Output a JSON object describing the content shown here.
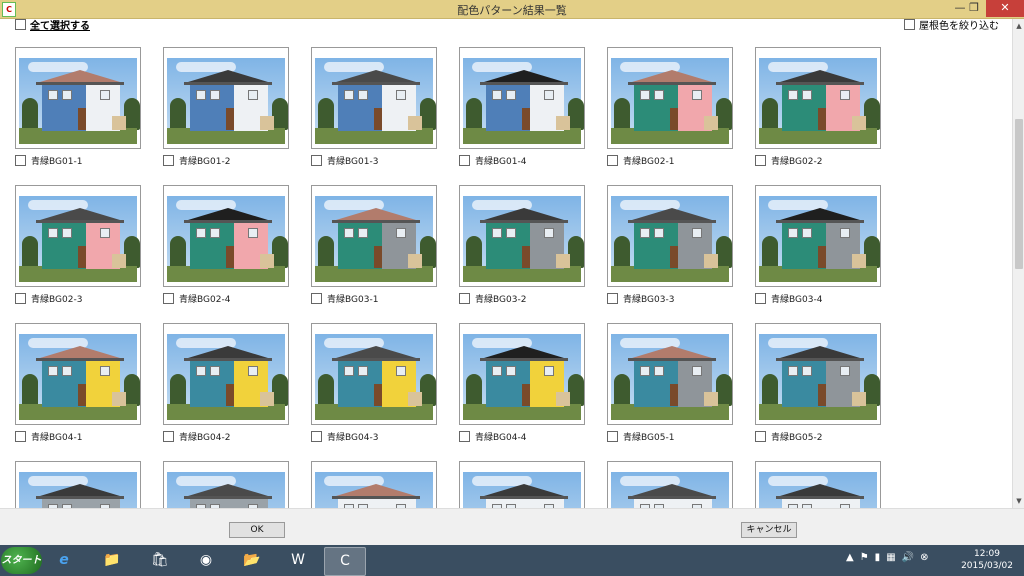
{
  "window": {
    "title": "配色パターン結果一覧",
    "minimize": "—",
    "restore": "❐",
    "close": "✕",
    "app_icon": "C"
  },
  "header": {
    "select_all_label": "全て選択する",
    "roof_filter_label": "屋根色を絞り込む"
  },
  "items": [
    {
      "label": "青緑BG01-1",
      "roof": "#b27c6c",
      "wall_left": "#4f7fb8",
      "wall_right": "#eef1f4"
    },
    {
      "label": "青緑BG01-2",
      "roof": "#3a3a3a",
      "wall_left": "#4f7fb8",
      "wall_right": "#eef1f4"
    },
    {
      "label": "青緑BG01-3",
      "roof": "#4a4a4a",
      "wall_left": "#4f7fb8",
      "wall_right": "#eef1f4"
    },
    {
      "label": "青緑BG01-4",
      "roof": "#1f1f1f",
      "wall_left": "#4f7fb8",
      "wall_right": "#eef1f4"
    },
    {
      "label": "青緑BG02-1",
      "roof": "#b27c6c",
      "wall_left": "#2c8c78",
      "wall_right": "#f1a7ac"
    },
    {
      "label": "青緑BG02-2",
      "roof": "#3a3a3a",
      "wall_left": "#2c8c78",
      "wall_right": "#f1a7ac"
    },
    {
      "label": "青緑BG02-3",
      "roof": "#4a4a4a",
      "wall_left": "#2c8c78",
      "wall_right": "#f1a7ac"
    },
    {
      "label": "青緑BG02-4",
      "roof": "#1f1f1f",
      "wall_left": "#2c8c78",
      "wall_right": "#f1a7ac"
    },
    {
      "label": "青緑BG03-1",
      "roof": "#b27c6c",
      "wall_left": "#2c8c78",
      "wall_right": "#8f959a"
    },
    {
      "label": "青緑BG03-2",
      "roof": "#3a3a3a",
      "wall_left": "#2c8c78",
      "wall_right": "#8f959a"
    },
    {
      "label": "青緑BG03-3",
      "roof": "#4a4a4a",
      "wall_left": "#2c8c78",
      "wall_right": "#8f959a"
    },
    {
      "label": "青緑BG03-4",
      "roof": "#1f1f1f",
      "wall_left": "#2c8c78",
      "wall_right": "#8f959a"
    },
    {
      "label": "青緑BG04-1",
      "roof": "#b27c6c",
      "wall_left": "#3a8aa0",
      "wall_right": "#f1d23b"
    },
    {
      "label": "青緑BG04-2",
      "roof": "#3a3a3a",
      "wall_left": "#3a8aa0",
      "wall_right": "#f1d23b"
    },
    {
      "label": "青緑BG04-3",
      "roof": "#4a4a4a",
      "wall_left": "#3a8aa0",
      "wall_right": "#f1d23b"
    },
    {
      "label": "青緑BG04-4",
      "roof": "#1f1f1f",
      "wall_left": "#3a8aa0",
      "wall_right": "#f1d23b"
    },
    {
      "label": "青緑BG05-1",
      "roof": "#b27c6c",
      "wall_left": "#3a8aa0",
      "wall_right": "#8f959a"
    },
    {
      "label": "青緑BG05-2",
      "roof": "#3a3a3a",
      "wall_left": "#3a8aa0",
      "wall_right": "#8f959a"
    },
    {
      "label": "",
      "roof": "#3a3a3a",
      "wall_left": "#9aa2a8",
      "wall_right": "#9aa2a8"
    },
    {
      "label": "",
      "roof": "#4a4a4a",
      "wall_left": "#9aa2a8",
      "wall_right": "#9aa2a8"
    },
    {
      "label": "",
      "roof": "#b27c6c",
      "wall_left": "#eef1f4",
      "wall_right": "#eef1f4"
    },
    {
      "label": "",
      "roof": "#3a3a3a",
      "wall_left": "#eef1f4",
      "wall_right": "#eef1f4"
    },
    {
      "label": "",
      "roof": "#4a4a4a",
      "wall_left": "#eef1f4",
      "wall_right": "#eef1f4"
    },
    {
      "label": "",
      "roof": "#3a3a3a",
      "wall_left": "#eef1f4",
      "wall_right": "#eef1f4"
    }
  ],
  "footer": {
    "ok_label": "OK",
    "cancel_label": "キャンセル"
  },
  "taskbar": {
    "start_label": "スタート",
    "apps": [
      {
        "name": "internet-explorer-icon",
        "glyph": "e"
      },
      {
        "name": "file-explorer-icon",
        "glyph": "📁"
      },
      {
        "name": "store-icon",
        "glyph": "🛍"
      },
      {
        "name": "chrome-icon",
        "glyph": "◉"
      },
      {
        "name": "folder-icon",
        "glyph": "📂"
      },
      {
        "name": "word-icon",
        "glyph": "W"
      },
      {
        "name": "color-app-icon",
        "glyph": "C"
      }
    ],
    "tray_icons": [
      "▲",
      "⚑",
      "▮",
      "▦",
      "🔊",
      "⊗"
    ],
    "time": "12:09",
    "date": "2015/03/02"
  }
}
